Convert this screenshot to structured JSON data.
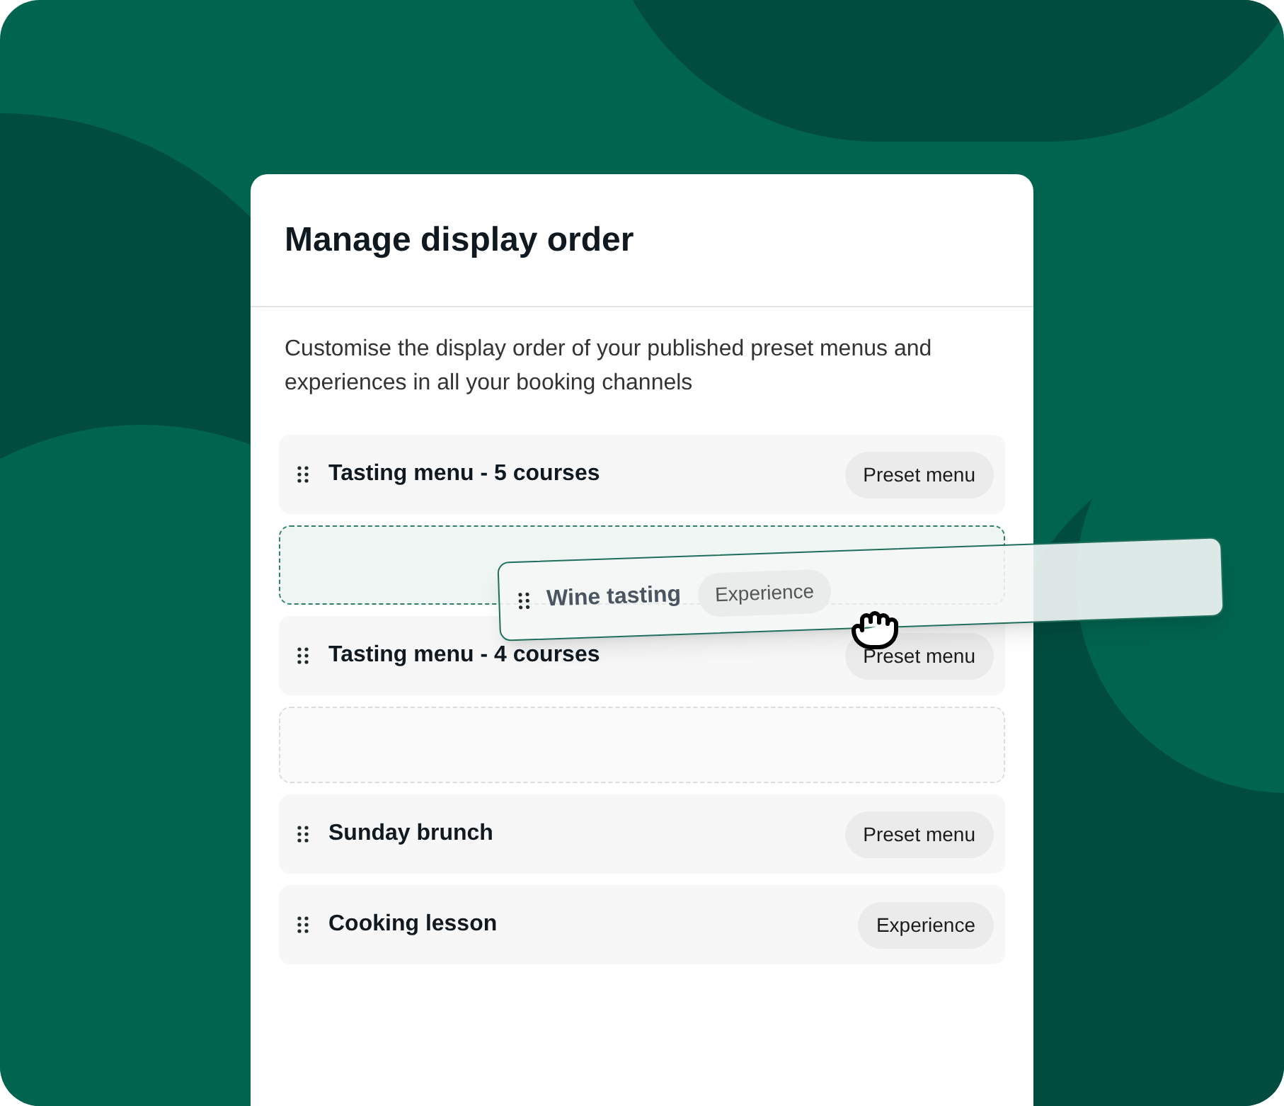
{
  "dialog": {
    "title": "Manage display order",
    "description": "Customise the display order of your published preset menus and experiences in all your booking channels"
  },
  "rows": [
    {
      "kind": "item",
      "title": "Tasting menu - 5 courses",
      "tag": "Preset menu"
    },
    {
      "kind": "drop-target"
    },
    {
      "kind": "item",
      "title": "Tasting menu - 4 courses",
      "tag": "Preset menu"
    },
    {
      "kind": "placeholder"
    },
    {
      "kind": "item",
      "title": "Sunday brunch",
      "tag": "Preset menu"
    },
    {
      "kind": "item",
      "title": "Cooking lesson",
      "tag": "Experience"
    }
  ],
  "dragging": {
    "title": "Wine tasting",
    "tag": "Experience"
  }
}
